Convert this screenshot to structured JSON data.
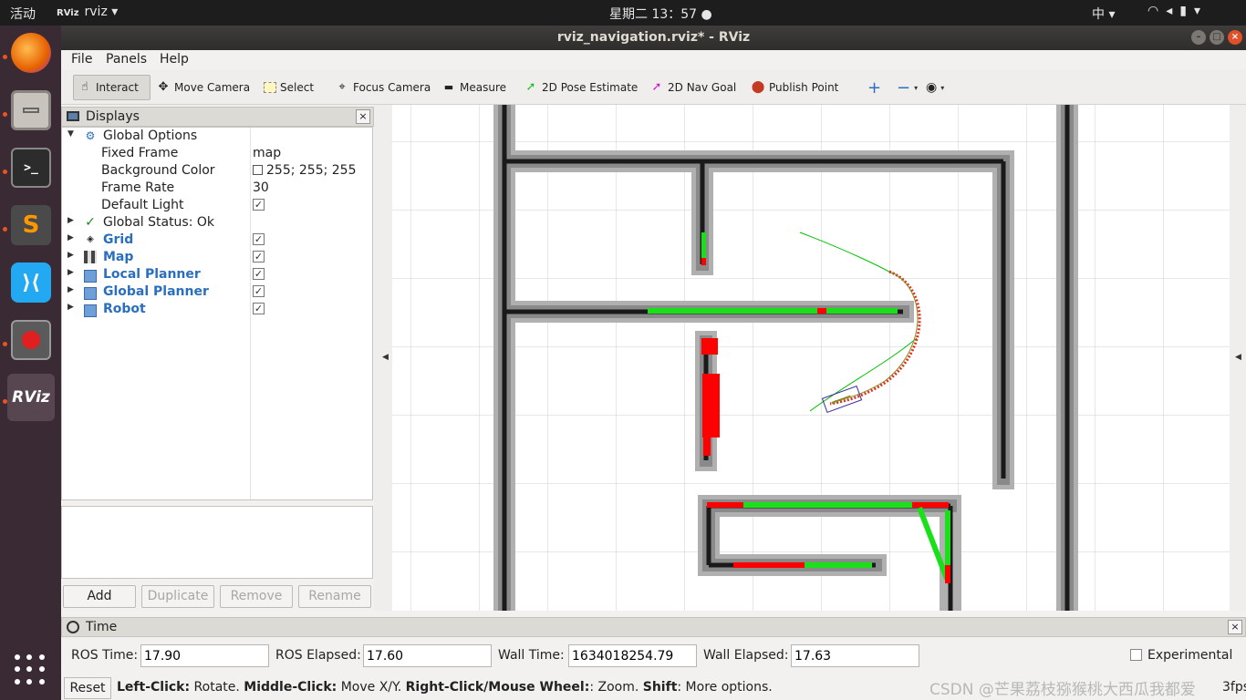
{
  "topbar": {
    "activities": "活动",
    "app_name": "rviz",
    "clock": "星期二 13：57",
    "input_method": "中",
    "app_glyph": "RViz"
  },
  "dock": {
    "items": [
      {
        "name": "firefox-icon",
        "running": true
      },
      {
        "name": "files-icon",
        "running": true
      },
      {
        "name": "terminal-icon",
        "running": true
      },
      {
        "name": "sublime-text-icon",
        "running": true
      },
      {
        "name": "vscode-icon",
        "running": false
      },
      {
        "name": "app-icon",
        "running": true
      },
      {
        "name": "rviz-icon",
        "running": true,
        "label": "RViz"
      }
    ]
  },
  "window": {
    "title": "rviz_navigation.rviz* - RViz"
  },
  "menu": {
    "file": "File",
    "panels": "Panels",
    "help": "Help"
  },
  "toolbar": {
    "interact": "Interact",
    "move_camera": "Move Camera",
    "select": "Select",
    "focus_camera": "Focus Camera",
    "measure": "Measure",
    "pose_estimate": "2D Pose Estimate",
    "nav_goal": "2D Nav Goal",
    "publish_point": "Publish Point",
    "add_icon": "plus-icon",
    "remove_icon": "minus-icon",
    "view_icon": "eye-icon"
  },
  "displays": {
    "title": "Displays",
    "global_options": "Global Options",
    "fixed_frame_label": "Fixed Frame",
    "fixed_frame_value": "map",
    "bg_color_label": "Background Color",
    "bg_color_value": "255; 255; 255",
    "frame_rate_label": "Frame Rate",
    "frame_rate_value": "30",
    "default_light_label": "Default Light",
    "default_light_checked": true,
    "global_status": "Global Status: Ok",
    "items": [
      {
        "label": "Grid",
        "checked": true
      },
      {
        "label": "Map",
        "checked": true
      },
      {
        "label": "Local Planner",
        "checked": true
      },
      {
        "label": "Global Planner",
        "checked": true
      },
      {
        "label": "Robot",
        "checked": true
      }
    ],
    "buttons": {
      "add": "Add",
      "duplicate": "Duplicate",
      "remove": "Remove",
      "rename": "Rename"
    }
  },
  "time": {
    "title": "Time",
    "ros_time_label": "ROS Time:",
    "ros_time_value": "17.90",
    "ros_elapsed_label": "ROS Elapsed:",
    "ros_elapsed_value": "17.60",
    "wall_time_label": "Wall Time:",
    "wall_time_value": "1634018254.79",
    "wall_elapsed_label": "Wall Elapsed:",
    "wall_elapsed_value": "17.63",
    "experimental_label": "Experimental"
  },
  "status": {
    "reset": "Reset",
    "hint_b1": "Left-Click:",
    "hint_t1": " Rotate. ",
    "hint_b2": "Middle-Click:",
    "hint_t2": " Move X/Y. ",
    "hint_b3": "Right-Click/Mouse Wheel:",
    "hint_t3": ": Zoom. ",
    "hint_b4": "Shift",
    "hint_t4": ": More options.",
    "fps": "3fps",
    "watermark": "CSDN @芒果荔枝猕猴桃大西瓜我都爱"
  },
  "colors": {
    "wall": "#1a1a1a",
    "inflation": "#9a9a9a",
    "global_path": "#00c000",
    "local_path": "#ff0000",
    "footprint": "#3a2aa0"
  }
}
